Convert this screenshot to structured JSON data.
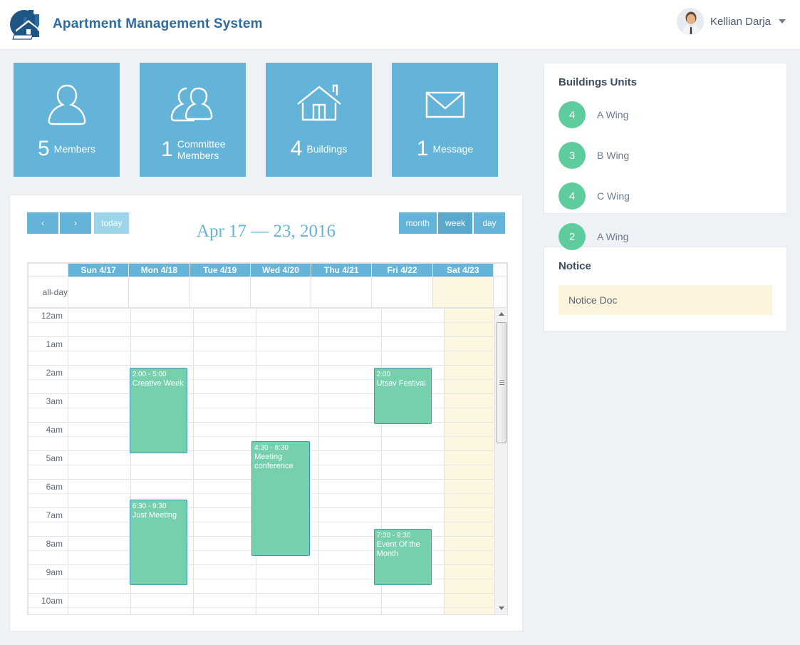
{
  "header": {
    "brand_title": "Apartment Management System",
    "logo_icon": "building-chart-logo-icon",
    "user_name": "Kellian Darja",
    "avatar_icon": "user-avatar",
    "caret_icon": "chevron-down-icon",
    "brand_color": "#2d6ca2"
  },
  "stats": [
    {
      "value": "5",
      "label": "Members",
      "icon": "single-person-icon",
      "two_line": false
    },
    {
      "value": "1",
      "label": "Committee Members",
      "icon": "two-people-icon",
      "two_line": true
    },
    {
      "value": "4",
      "label": "Buildings",
      "icon": "house-icon",
      "two_line": false
    },
    {
      "value": "1",
      "label": "Message",
      "icon": "envelope-icon",
      "two_line": false
    }
  ],
  "stat_color": "#63b4d8",
  "buildings_panel": {
    "title": "Buildings Units",
    "badge_color": "#5fcc9d",
    "units": [
      {
        "count": "4",
        "name": "A Wing"
      },
      {
        "count": "3",
        "name": "B Wing"
      },
      {
        "count": "4",
        "name": "C Wing"
      },
      {
        "count": "2",
        "name": "A Wing"
      }
    ]
  },
  "notice_panel": {
    "title": "Notice",
    "items": [
      {
        "label": "Notice Doc"
      }
    ],
    "item_bg": "#fdf4de"
  },
  "calendar": {
    "title": "Apr 17 — 23, 2016",
    "prev_label": "‹",
    "next_label": "›",
    "today_label": "today",
    "views": [
      {
        "label": "month",
        "active": false
      },
      {
        "label": "week",
        "active": true
      },
      {
        "label": "day",
        "active": false
      }
    ],
    "day_headers": [
      "Sun 4/17",
      "Mon 4/18",
      "Tue 4/19",
      "Wed 4/20",
      "Thu 4/21",
      "Fri 4/22",
      "Sat 4/23"
    ],
    "today_column_index": 6,
    "allday_label": "all-day",
    "hour_labels": [
      "12am",
      "1am",
      "2am",
      "3am",
      "4am",
      "5am",
      "6am",
      "7am",
      "8am",
      "9am",
      "10am"
    ],
    "event_color": "#76d0ae",
    "event_border_color": "#3e98b9",
    "events": [
      {
        "time": "2:00 - 5:00",
        "title": "Creative Week",
        "day": 1,
        "start_hour": 2.0,
        "end_hour": 5.0
      },
      {
        "time": "2:00",
        "title": "Utsav Festival",
        "day": 5,
        "start_hour": 2.0,
        "end_hour": 4.0
      },
      {
        "time": "4:30 - 8:30",
        "title": "Meeting conference",
        "day": 3,
        "start_hour": 4.5,
        "end_hour": 8.5
      },
      {
        "time": "6:30 - 9:30",
        "title": "Just Meeting",
        "day": 1,
        "start_hour": 6.5,
        "end_hour": 9.5
      },
      {
        "time": "7:30 - 9:30",
        "title": "Event Of the Month",
        "day": 5,
        "start_hour": 7.5,
        "end_hour": 9.5
      }
    ],
    "scrollbar": {
      "up_icon": "scroll-up-arrow-icon",
      "down_icon": "scroll-down-arrow-icon"
    }
  }
}
